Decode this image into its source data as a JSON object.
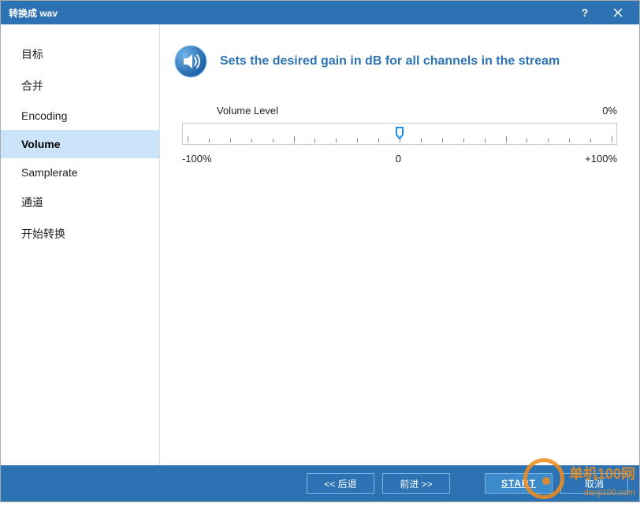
{
  "window": {
    "title": "转换成 wav",
    "help": "?",
    "close": "×"
  },
  "sidebar": {
    "items": [
      {
        "label": "目标"
      },
      {
        "label": "合并"
      },
      {
        "label": "Encoding"
      },
      {
        "label": "Volume",
        "selected": true
      },
      {
        "label": "Samplerate"
      },
      {
        "label": "通道"
      },
      {
        "label": "开始转换"
      }
    ]
  },
  "content": {
    "heading": "Sets the desired gain in dB for all channels in the stream",
    "field_label": "Volume Level",
    "value_text": "0%",
    "min_label": "-100%",
    "center_label": "0",
    "max_label": "+100%",
    "slider": {
      "min": -100,
      "max": 100,
      "value": 0
    }
  },
  "footer": {
    "back": "<< 后退",
    "forward": "前进 >>",
    "start": "START",
    "cancel": "取消"
  },
  "watermark": {
    "line1": "单机100网",
    "line2": "danji100.com"
  }
}
